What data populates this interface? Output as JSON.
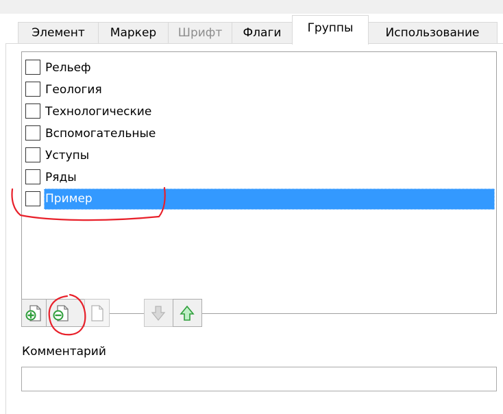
{
  "tabs": [
    {
      "label": "Элемент",
      "state": "normal"
    },
    {
      "label": "Маркер",
      "state": "normal"
    },
    {
      "label": "Шрифт",
      "state": "disabled"
    },
    {
      "label": "Флаги",
      "state": "normal"
    },
    {
      "label": "Группы",
      "state": "active"
    },
    {
      "label": "Использование",
      "state": "normal"
    }
  ],
  "groups": {
    "items": [
      {
        "label": "Рельеф",
        "checked": false
      },
      {
        "label": "Геология",
        "checked": false
      },
      {
        "label": "Технологические",
        "checked": false
      },
      {
        "label": "Вспомогательные",
        "checked": false
      },
      {
        "label": "Уступы",
        "checked": false
      },
      {
        "label": "Ряды",
        "checked": false
      },
      {
        "label": "Пример",
        "checked": false,
        "selected": true
      }
    ]
  },
  "toolbar": {
    "buttons": [
      {
        "icon": "add-group-icon",
        "enabled": true
      },
      {
        "icon": "remove-group-icon",
        "enabled": true
      },
      {
        "icon": "document-icon",
        "enabled": false
      },
      {
        "icon": "arrow-down-icon",
        "enabled": false
      },
      {
        "icon": "arrow-up-icon",
        "enabled": true
      }
    ]
  },
  "comment": {
    "label": "Комментарий",
    "value": ""
  },
  "colors": {
    "selection": "#3399ff",
    "annotation": "#e8202a",
    "icon_green": "#2e9e3a",
    "icon_disabled": "#b4b4b4"
  }
}
